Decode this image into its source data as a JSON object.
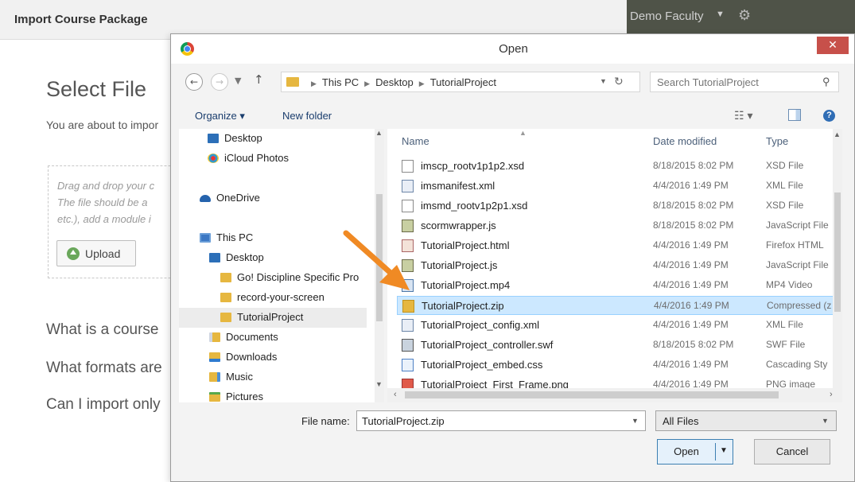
{
  "page": {
    "header_title": "Import Course Package",
    "account_name": "Demo Faculty",
    "select_title": "Select File",
    "about_text": "You are about to impor",
    "dropzone_lines": [
      "Drag and drop your c",
      "The file should be a",
      "etc.), add a module i"
    ],
    "upload_label": "Upload",
    "faq": [
      "What is a course",
      "What formats are",
      "Can I import only"
    ]
  },
  "dialog": {
    "title": "Open",
    "close_glyph": "✕",
    "breadcrumb": [
      "This PC",
      "Desktop",
      "TutorialProject"
    ],
    "search_placeholder": "Search TutorialProject",
    "organize_label": "Organize ▾",
    "new_folder_label": "New folder",
    "nav_items": [
      {
        "label": "Desktop",
        "icon": "desktop-icon"
      },
      {
        "label": "iCloud Photos",
        "icon": "icloud-icon"
      },
      {
        "label": "OneDrive",
        "icon": "onedrive-icon"
      },
      {
        "label": "This PC",
        "icon": "computer-icon"
      },
      {
        "label": "Desktop",
        "icon": "desktop-icon"
      },
      {
        "label": "Go! Discipline Specific Pro",
        "icon": "folder-icon"
      },
      {
        "label": "record-your-screen",
        "icon": "folder-icon"
      },
      {
        "label": "TutorialProject",
        "icon": "folder-icon",
        "selected": true
      },
      {
        "label": "Documents",
        "icon": "documents-icon"
      },
      {
        "label": "Downloads",
        "icon": "downloads-icon"
      },
      {
        "label": "Music",
        "icon": "music-icon"
      },
      {
        "label": "Pictures",
        "icon": "pictures-icon"
      }
    ],
    "columns": {
      "name": "Name",
      "date": "Date modified",
      "type": "Type"
    },
    "files": [
      {
        "name": "imscp_rootv1p1p2.xsd",
        "date": "8/18/2015 8:02 PM",
        "type": "XSD File",
        "kind": "xsd"
      },
      {
        "name": "imsmanifest.xml",
        "date": "4/4/2016 1:49 PM",
        "type": "XML File",
        "kind": "xml"
      },
      {
        "name": "imsmd_rootv1p2p1.xsd",
        "date": "8/18/2015 8:02 PM",
        "type": "XSD File",
        "kind": "xsd"
      },
      {
        "name": "scormwrapper.js",
        "date": "8/18/2015 8:02 PM",
        "type": "JavaScript File",
        "kind": "js"
      },
      {
        "name": "TutorialProject.html",
        "date": "4/4/2016 1:49 PM",
        "type": "Firefox HTML",
        "kind": "html"
      },
      {
        "name": "TutorialProject.js",
        "date": "4/4/2016 1:49 PM",
        "type": "JavaScript File",
        "kind": "js"
      },
      {
        "name": "TutorialProject.mp4",
        "date": "4/4/2016 1:49 PM",
        "type": "MP4 Video",
        "kind": "mp4"
      },
      {
        "name": "TutorialProject.zip",
        "date": "4/4/2016 1:49 PM",
        "type": "Compressed (z",
        "kind": "zip",
        "selected": true
      },
      {
        "name": "TutorialProject_config.xml",
        "date": "4/4/2016 1:49 PM",
        "type": "XML File",
        "kind": "xml"
      },
      {
        "name": "TutorialProject_controller.swf",
        "date": "8/18/2015 8:02 PM",
        "type": "SWF File",
        "kind": "swf"
      },
      {
        "name": "TutorialProject_embed.css",
        "date": "4/4/2016 1:49 PM",
        "type": "Cascading Sty",
        "kind": "css"
      },
      {
        "name": "TutorialProject_First_Frame.png",
        "date": "4/4/2016 1:49 PM",
        "type": "PNG image",
        "kind": "png"
      }
    ],
    "file_name_label": "File name:",
    "file_name_value": "TutorialProject.zip",
    "file_type_value": "All Files",
    "open_label": "Open",
    "cancel_label": "Cancel"
  },
  "colors": {
    "accent_arrow": "#f08a24",
    "selection": "#cce8ff",
    "close": "#c7504a"
  }
}
